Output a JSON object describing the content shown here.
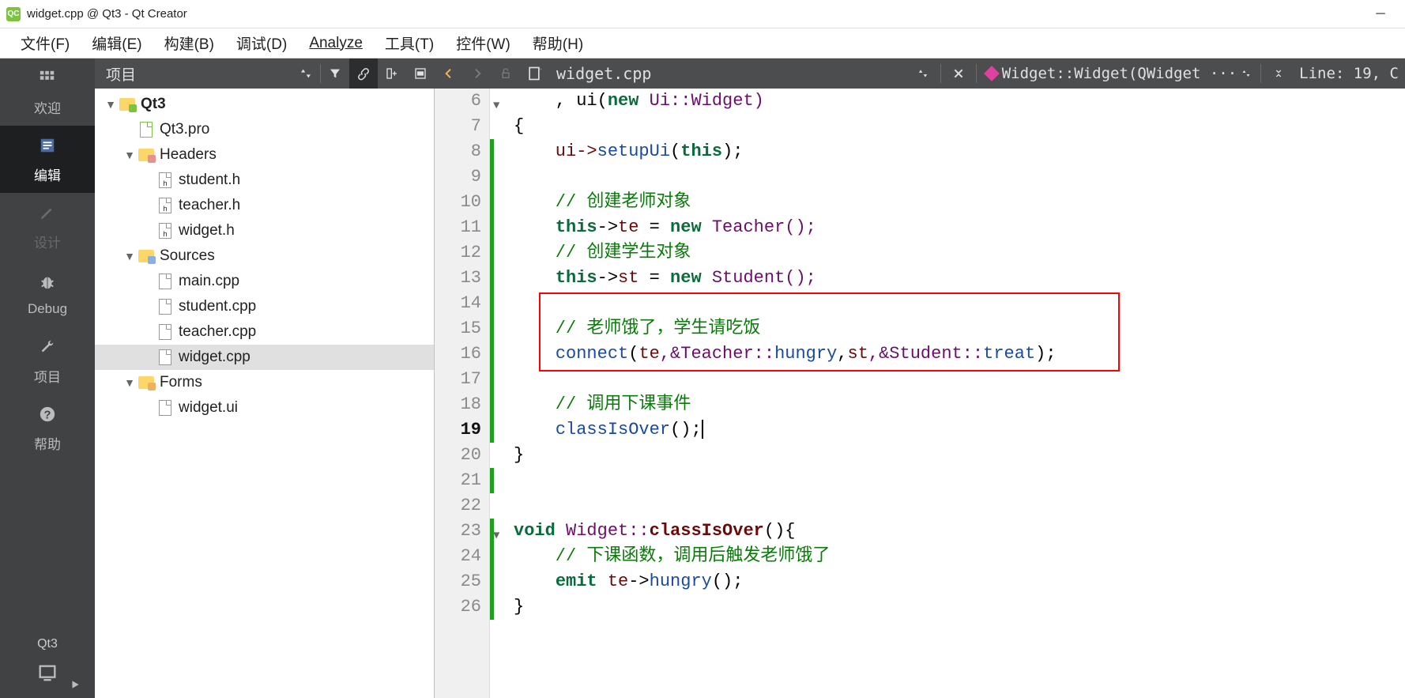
{
  "titlebar": {
    "qt_icon_text": "QC",
    "title": "widget.cpp @ Qt3 - Qt Creator"
  },
  "menu": {
    "file": "文件(F)",
    "edit": "编辑(E)",
    "build": "构建(B)",
    "debug_menu": "调试(D)",
    "analyze": "Analyze",
    "tools": "工具(T)",
    "widgets": "控件(W)",
    "help": "帮助(H)"
  },
  "modes": {
    "welcome": "欢迎",
    "edit": "编辑",
    "design": "设计",
    "debug": "Debug",
    "projects": "项目",
    "help": "帮助"
  },
  "kit": {
    "name": "Qt3"
  },
  "project_panel": {
    "label": "项目"
  },
  "tree": {
    "root": "Qt3",
    "pro": "Qt3.pro",
    "headers": "Headers",
    "h1": "student.h",
    "h2": "teacher.h",
    "h3": "widget.h",
    "sources": "Sources",
    "s1": "main.cpp",
    "s2": "student.cpp",
    "s3": "teacher.cpp",
    "s4": "widget.cpp",
    "forms": "Forms",
    "f1": "widget.ui"
  },
  "editor_toolbar": {
    "filename": "widget.cpp",
    "symbol": "Widget::Widget(QWidget ···",
    "linecol": "Line: 19, C"
  },
  "code": {
    "lines": [
      "6",
      "7",
      "8",
      "9",
      "10",
      "11",
      "12",
      "13",
      "14",
      "15",
      "16",
      "17",
      "18",
      "19",
      "20",
      "21",
      "22",
      "23",
      "24",
      "25",
      "26"
    ],
    "l6a": "    , ui(",
    "l6b": "new",
    "l6c": " Ui::Widget)",
    "l7": "{",
    "l8a": "    ui->",
    "l8b": "setupUi",
    "l8c": "(",
    "l8d": "this",
    "l8e": ");",
    "l10": "    // 创建老师对象",
    "l11a": "    ",
    "l11b": "this",
    "l11c": "->",
    "l11d": "te",
    "l11e": " = ",
    "l11f": "new",
    "l11g": " Teacher();",
    "l12": "    // 创建学生对象",
    "l13a": "    ",
    "l13b": "this",
    "l13c": "->",
    "l13d": "st",
    "l13e": " = ",
    "l13f": "new",
    "l13g": " Student();",
    "l15": "    // 老师饿了，学生请吃饭",
    "l16a": "    ",
    "l16b": "connect",
    "l16c": "(",
    "l16d": "te",
    "l16e": ",&Teacher::",
    "l16f": "hungry",
    "l16g": ",",
    "l16h": "st",
    "l16i": ",&Student::",
    "l16j": "treat",
    "l16k": ");",
    "l18": "    // 调用下课事件",
    "l19a": "    ",
    "l19b": "classIsOver",
    "l19c": "();",
    "l20": "}",
    "l23a": "void",
    "l23b": " Widget::",
    "l23c": "classIsOver",
    "l23d": "(){",
    "l24": "    // 下课函数，调用后触发老师饿了",
    "l25a": "    ",
    "l25b": "emit",
    "l25c": " ",
    "l25d": "te",
    "l25e": "->",
    "l25f": "hungry",
    "l25g": "();",
    "l26": "}"
  }
}
